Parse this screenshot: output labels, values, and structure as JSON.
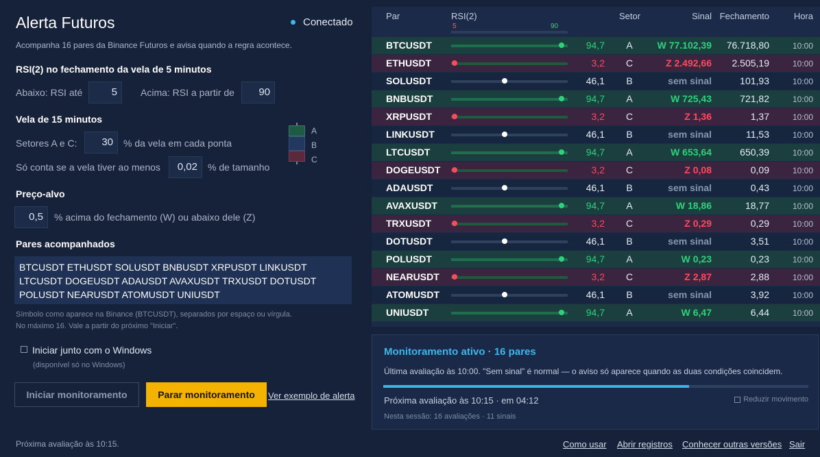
{
  "app": {
    "title": "Alerta Futuros",
    "status": "Conectado",
    "subtitle": "Acompanha 16 pares da Binance Futuros e avisa quando a regra acontece."
  },
  "rsi_section": {
    "heading": "RSI(2) no fechamento da vela de 5 minutos",
    "below_label": "Abaixo: RSI até",
    "below_value": "5",
    "above_label": "Acima: RSI a partir de",
    "above_value": "90"
  },
  "candle_section": {
    "heading": "Vela de 15 minutos",
    "sectors_label": "Setores A e C:",
    "sectors_value": "30",
    "sectors_suffix": "% da vela em cada ponta",
    "min_label": "Só conta se a vela tiver ao menos",
    "min_value": "0,02",
    "min_suffix": "% de tamanho",
    "legend": [
      "A",
      "B",
      "C"
    ]
  },
  "target_section": {
    "heading": "Preço-alvo",
    "value": "0,5",
    "suffix": "% acima do fechamento (W) ou abaixo dele (Z)"
  },
  "pairs_section": {
    "heading": "Pares acompanhados",
    "text": "BTCUSDT ETHUSDT SOLUSDT BNBUSDT XRPUSDT LINKUSDT LTCUSDT DOGEUSDT ADAUSDT AVAXUSDT TRXUSDT DOTUSDT POLUSDT NEARUSDT ATOMUSDT UNIUSDT",
    "hint1": "Símbolo como aparece na Binance (BTCUSDT), separados por espaço ou vírgula.",
    "hint2": "No máximo 16. Vale a partir do próximo \"Iniciar\"."
  },
  "windows": {
    "label": "Iniciar junto com o Windows",
    "note": "(disponível só no Windows)",
    "checked": false
  },
  "buttons": {
    "start": "Iniciar monitoramento",
    "stop": "Parar monitoramento",
    "example": "Ver exemplo de alerta"
  },
  "footer": {
    "next": "Próxima avaliação às 10:15.",
    "links": [
      "Como usar",
      "Abrir registros",
      "Conhecer outras versões",
      "Sair"
    ]
  },
  "table": {
    "headers": {
      "pair": "Par",
      "rsi": "RSI(2)",
      "setor": "Setor",
      "sinal": "Sinal",
      "fech": "Fechamento",
      "hora": "Hora"
    },
    "scale": {
      "low": "5",
      "high": "90"
    },
    "rows": [
      {
        "pair": "BTCUSDT",
        "rsi": "94,7",
        "rsi_num": 94.7,
        "setor": "A",
        "sinal": "W 77.102,39",
        "fech": "76.718,80",
        "hora": "10:00",
        "kind": "W"
      },
      {
        "pair": "ETHUSDT",
        "rsi": "3,2",
        "rsi_num": 3.2,
        "setor": "C",
        "sinal": "Z 2.492,66",
        "fech": "2.505,19",
        "hora": "10:00",
        "kind": "Z"
      },
      {
        "pair": "SOLUSDT",
        "rsi": "46,1",
        "rsi_num": 46.1,
        "setor": "B",
        "sinal": "sem sinal",
        "fech": "101,93",
        "hora": "10:00",
        "kind": "N"
      },
      {
        "pair": "BNBUSDT",
        "rsi": "94,7",
        "rsi_num": 94.7,
        "setor": "A",
        "sinal": "W 725,43",
        "fech": "721,82",
        "hora": "10:00",
        "kind": "W"
      },
      {
        "pair": "XRPUSDT",
        "rsi": "3,2",
        "rsi_num": 3.2,
        "setor": "C",
        "sinal": "Z 1,36",
        "fech": "1,37",
        "hora": "10:00",
        "kind": "Z"
      },
      {
        "pair": "LINKUSDT",
        "rsi": "46,1",
        "rsi_num": 46.1,
        "setor": "B",
        "sinal": "sem sinal",
        "fech": "11,53",
        "hora": "10:00",
        "kind": "N"
      },
      {
        "pair": "LTCUSDT",
        "rsi": "94,7",
        "rsi_num": 94.7,
        "setor": "A",
        "sinal": "W 653,64",
        "fech": "650,39",
        "hora": "10:00",
        "kind": "W"
      },
      {
        "pair": "DOGEUSDT",
        "rsi": "3,2",
        "rsi_num": 3.2,
        "setor": "C",
        "sinal": "Z 0,08",
        "fech": "0,09",
        "hora": "10:00",
        "kind": "Z"
      },
      {
        "pair": "ADAUSDT",
        "rsi": "46,1",
        "rsi_num": 46.1,
        "setor": "B",
        "sinal": "sem sinal",
        "fech": "0,43",
        "hora": "10:00",
        "kind": "N"
      },
      {
        "pair": "AVAXUSDT",
        "rsi": "94,7",
        "rsi_num": 94.7,
        "setor": "A",
        "sinal": "W 18,86",
        "fech": "18,77",
        "hora": "10:00",
        "kind": "W"
      },
      {
        "pair": "TRXUSDT",
        "rsi": "3,2",
        "rsi_num": 3.2,
        "setor": "C",
        "sinal": "Z 0,29",
        "fech": "0,29",
        "hora": "10:00",
        "kind": "Z"
      },
      {
        "pair": "DOTUSDT",
        "rsi": "46,1",
        "rsi_num": 46.1,
        "setor": "B",
        "sinal": "sem sinal",
        "fech": "3,51",
        "hora": "10:00",
        "kind": "N"
      },
      {
        "pair": "POLUSDT",
        "rsi": "94,7",
        "rsi_num": 94.7,
        "setor": "A",
        "sinal": "W 0,23",
        "fech": "0,23",
        "hora": "10:00",
        "kind": "W"
      },
      {
        "pair": "NEARUSDT",
        "rsi": "3,2",
        "rsi_num": 3.2,
        "setor": "C",
        "sinal": "Z 2,87",
        "fech": "2,88",
        "hora": "10:00",
        "kind": "Z"
      },
      {
        "pair": "ATOMUSDT",
        "rsi": "46,1",
        "rsi_num": 46.1,
        "setor": "B",
        "sinal": "sem sinal",
        "fech": "3,92",
        "hora": "10:00",
        "kind": "N"
      },
      {
        "pair": "UNIUSDT",
        "rsi": "94,7",
        "rsi_num": 94.7,
        "setor": "A",
        "sinal": "W 6,47",
        "fech": "6,44",
        "hora": "10:00",
        "kind": "W"
      }
    ]
  },
  "monitor": {
    "title": "Monitoramento ativo · 16 pares",
    "text": "Última avaliação às 10:00. \"Sem sinal\" é normal — o aviso só aparece quando as duas condições coincidem.",
    "progress": 0.72,
    "next": "Próxima avaliação às 10:15 · em 04:12",
    "reduce_motion": "Reduzir movimento",
    "session": "Nesta sessão: 16 avaliações · 11 sinais"
  },
  "colors": {
    "w_signal": "#2fd17a",
    "z_signal": "#ff4a5e",
    "neutral_signal": "#8797b0",
    "accent": "#3fb6ea",
    "stop_button": "#f5b301"
  }
}
